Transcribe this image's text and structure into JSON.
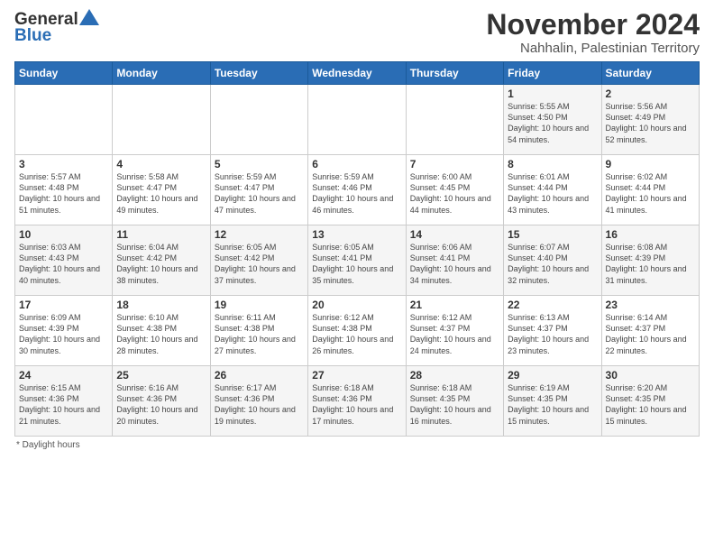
{
  "header": {
    "logo_general": "General",
    "logo_blue": "Blue",
    "month_title": "November 2024",
    "location": "Nahhalin, Palestinian Territory"
  },
  "days_of_week": [
    "Sunday",
    "Monday",
    "Tuesday",
    "Wednesday",
    "Thursday",
    "Friday",
    "Saturday"
  ],
  "weeks": [
    [
      {
        "num": "",
        "info": ""
      },
      {
        "num": "",
        "info": ""
      },
      {
        "num": "",
        "info": ""
      },
      {
        "num": "",
        "info": ""
      },
      {
        "num": "",
        "info": ""
      },
      {
        "num": "1",
        "info": "Sunrise: 5:55 AM\nSunset: 4:50 PM\nDaylight: 10 hours and 54 minutes."
      },
      {
        "num": "2",
        "info": "Sunrise: 5:56 AM\nSunset: 4:49 PM\nDaylight: 10 hours and 52 minutes."
      }
    ],
    [
      {
        "num": "3",
        "info": "Sunrise: 5:57 AM\nSunset: 4:48 PM\nDaylight: 10 hours and 51 minutes."
      },
      {
        "num": "4",
        "info": "Sunrise: 5:58 AM\nSunset: 4:47 PM\nDaylight: 10 hours and 49 minutes."
      },
      {
        "num": "5",
        "info": "Sunrise: 5:59 AM\nSunset: 4:47 PM\nDaylight: 10 hours and 47 minutes."
      },
      {
        "num": "6",
        "info": "Sunrise: 5:59 AM\nSunset: 4:46 PM\nDaylight: 10 hours and 46 minutes."
      },
      {
        "num": "7",
        "info": "Sunrise: 6:00 AM\nSunset: 4:45 PM\nDaylight: 10 hours and 44 minutes."
      },
      {
        "num": "8",
        "info": "Sunrise: 6:01 AM\nSunset: 4:44 PM\nDaylight: 10 hours and 43 minutes."
      },
      {
        "num": "9",
        "info": "Sunrise: 6:02 AM\nSunset: 4:44 PM\nDaylight: 10 hours and 41 minutes."
      }
    ],
    [
      {
        "num": "10",
        "info": "Sunrise: 6:03 AM\nSunset: 4:43 PM\nDaylight: 10 hours and 40 minutes."
      },
      {
        "num": "11",
        "info": "Sunrise: 6:04 AM\nSunset: 4:42 PM\nDaylight: 10 hours and 38 minutes."
      },
      {
        "num": "12",
        "info": "Sunrise: 6:05 AM\nSunset: 4:42 PM\nDaylight: 10 hours and 37 minutes."
      },
      {
        "num": "13",
        "info": "Sunrise: 6:05 AM\nSunset: 4:41 PM\nDaylight: 10 hours and 35 minutes."
      },
      {
        "num": "14",
        "info": "Sunrise: 6:06 AM\nSunset: 4:41 PM\nDaylight: 10 hours and 34 minutes."
      },
      {
        "num": "15",
        "info": "Sunrise: 6:07 AM\nSunset: 4:40 PM\nDaylight: 10 hours and 32 minutes."
      },
      {
        "num": "16",
        "info": "Sunrise: 6:08 AM\nSunset: 4:39 PM\nDaylight: 10 hours and 31 minutes."
      }
    ],
    [
      {
        "num": "17",
        "info": "Sunrise: 6:09 AM\nSunset: 4:39 PM\nDaylight: 10 hours and 30 minutes."
      },
      {
        "num": "18",
        "info": "Sunrise: 6:10 AM\nSunset: 4:38 PM\nDaylight: 10 hours and 28 minutes."
      },
      {
        "num": "19",
        "info": "Sunrise: 6:11 AM\nSunset: 4:38 PM\nDaylight: 10 hours and 27 minutes."
      },
      {
        "num": "20",
        "info": "Sunrise: 6:12 AM\nSunset: 4:38 PM\nDaylight: 10 hours and 26 minutes."
      },
      {
        "num": "21",
        "info": "Sunrise: 6:12 AM\nSunset: 4:37 PM\nDaylight: 10 hours and 24 minutes."
      },
      {
        "num": "22",
        "info": "Sunrise: 6:13 AM\nSunset: 4:37 PM\nDaylight: 10 hours and 23 minutes."
      },
      {
        "num": "23",
        "info": "Sunrise: 6:14 AM\nSunset: 4:37 PM\nDaylight: 10 hours and 22 minutes."
      }
    ],
    [
      {
        "num": "24",
        "info": "Sunrise: 6:15 AM\nSunset: 4:36 PM\nDaylight: 10 hours and 21 minutes."
      },
      {
        "num": "25",
        "info": "Sunrise: 6:16 AM\nSunset: 4:36 PM\nDaylight: 10 hours and 20 minutes."
      },
      {
        "num": "26",
        "info": "Sunrise: 6:17 AM\nSunset: 4:36 PM\nDaylight: 10 hours and 19 minutes."
      },
      {
        "num": "27",
        "info": "Sunrise: 6:18 AM\nSunset: 4:36 PM\nDaylight: 10 hours and 17 minutes."
      },
      {
        "num": "28",
        "info": "Sunrise: 6:18 AM\nSunset: 4:35 PM\nDaylight: 10 hours and 16 minutes."
      },
      {
        "num": "29",
        "info": "Sunrise: 6:19 AM\nSunset: 4:35 PM\nDaylight: 10 hours and 15 minutes."
      },
      {
        "num": "30",
        "info": "Sunrise: 6:20 AM\nSunset: 4:35 PM\nDaylight: 10 hours and 15 minutes."
      }
    ]
  ],
  "footer": {
    "daylight_label": "Daylight hours"
  }
}
